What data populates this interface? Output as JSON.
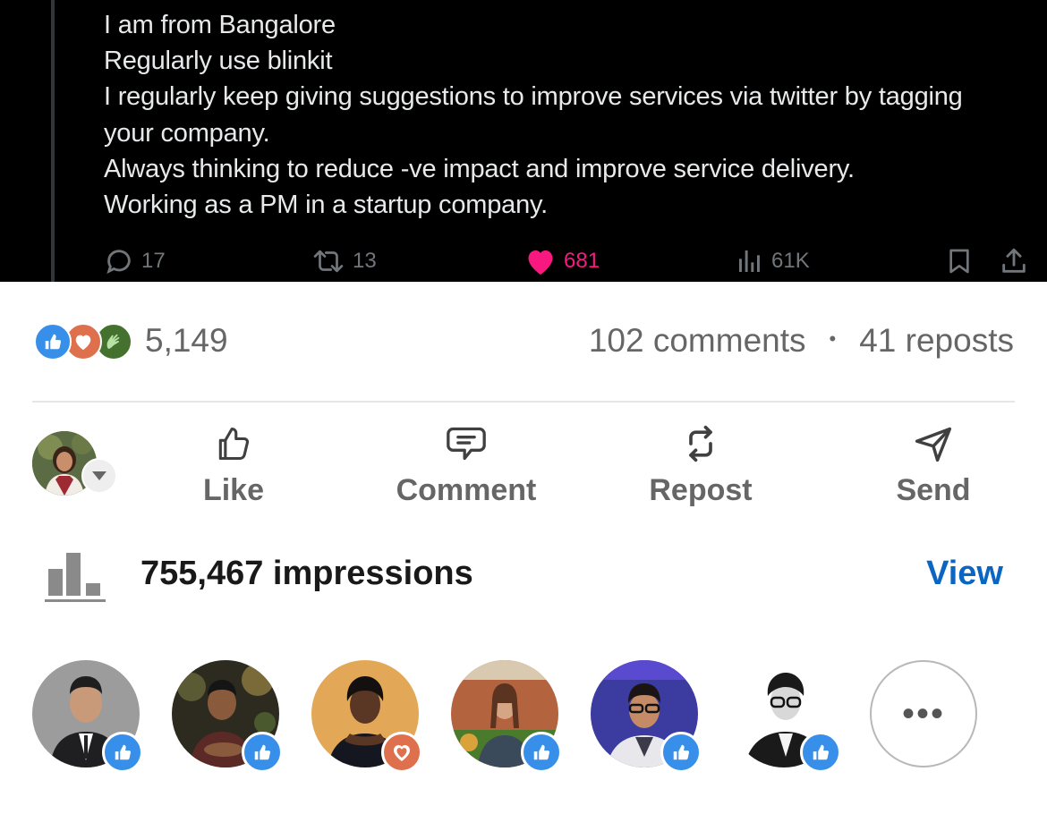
{
  "tweet": {
    "lines": [
      "I am from Bangalore",
      "Regularly use blinkit",
      "I regularly keep giving suggestions to improve services via twitter by tagging",
      "your company.",
      "Always thinking to reduce -ve impact and improve service delivery.",
      "Working as a PM in a startup company."
    ],
    "replies": "17",
    "retweets": "13",
    "likes": "681",
    "views": "61K"
  },
  "social": {
    "reaction_count": "5,149",
    "comments": "102 comments",
    "separator": "•",
    "reposts": "41 reposts",
    "reaction_types": [
      "like-icon",
      "love-icon",
      "celebrate-icon"
    ]
  },
  "actions": {
    "like": "Like",
    "comment": "Comment",
    "repost": "Repost",
    "send": "Send"
  },
  "impressions": {
    "text": "755,467 impressions",
    "view_label": "View"
  },
  "reactors": [
    {
      "reaction": "like"
    },
    {
      "reaction": "like"
    },
    {
      "reaction": "love"
    },
    {
      "reaction": "like"
    },
    {
      "reaction": "like"
    },
    {
      "reaction": "like"
    }
  ],
  "more_label": "•••",
  "colors": {
    "tweet_bg": "#000000",
    "tweet_text": "#e7e9ea",
    "tweet_muted": "#71767b",
    "tweet_like": "#f91880",
    "linkedin_blue": "#0a66c2",
    "like_blue": "#378fe9",
    "love_orange": "#df704d",
    "celebrate_green": "#44712e"
  }
}
